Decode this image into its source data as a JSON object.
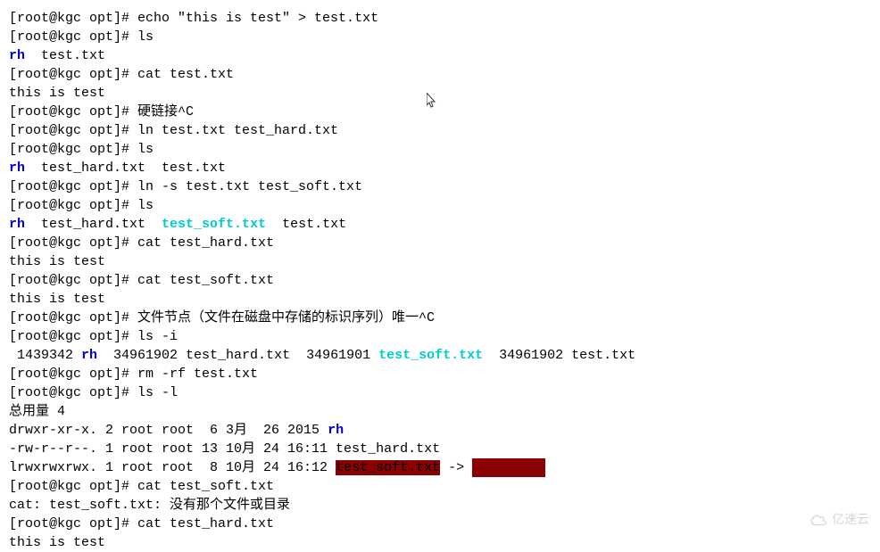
{
  "lines": [
    {
      "parts": [
        {
          "text": "[root@kgc opt]# echo \"this is test\" > test.txt"
        }
      ]
    },
    {
      "parts": [
        {
          "text": "[root@kgc opt]# ls"
        }
      ]
    },
    {
      "parts": [
        {
          "text": "rh",
          "cls": "blue"
        },
        {
          "text": "  test.txt"
        }
      ]
    },
    {
      "parts": [
        {
          "text": "[root@kgc opt]# cat test.txt"
        }
      ]
    },
    {
      "parts": [
        {
          "text": "this is test"
        }
      ]
    },
    {
      "parts": [
        {
          "text": "[root@kgc opt]# 硬链接^C"
        }
      ]
    },
    {
      "parts": [
        {
          "text": "[root@kgc opt]# ln test.txt test_hard.txt"
        }
      ]
    },
    {
      "parts": [
        {
          "text": "[root@kgc opt]# ls"
        }
      ]
    },
    {
      "parts": [
        {
          "text": "rh",
          "cls": "blue"
        },
        {
          "text": "  test_hard.txt  test.txt"
        }
      ]
    },
    {
      "parts": [
        {
          "text": "[root@kgc opt]# ln -s test.txt test_soft.txt"
        }
      ]
    },
    {
      "parts": [
        {
          "text": "[root@kgc opt]# ls"
        }
      ]
    },
    {
      "parts": [
        {
          "text": "rh",
          "cls": "blue"
        },
        {
          "text": "  test_hard.txt  "
        },
        {
          "text": "test_soft.txt",
          "cls": "cyan"
        },
        {
          "text": "  test.txt"
        }
      ]
    },
    {
      "parts": [
        {
          "text": "[root@kgc opt]# cat test_hard.txt"
        }
      ]
    },
    {
      "parts": [
        {
          "text": "this is test"
        }
      ]
    },
    {
      "parts": [
        {
          "text": "[root@kgc opt]# cat test_soft.txt"
        }
      ]
    },
    {
      "parts": [
        {
          "text": "this is test"
        }
      ]
    },
    {
      "parts": [
        {
          "text": "[root@kgc opt]# 文件节点（文件在磁盘中存储的标识序列）唯一^C"
        }
      ]
    },
    {
      "parts": [
        {
          "text": "[root@kgc opt]# ls -i"
        }
      ]
    },
    {
      "parts": [
        {
          "text": " 1439342 "
        },
        {
          "text": "rh",
          "cls": "blue"
        },
        {
          "text": "  34961902 test_hard.txt  34961901 "
        },
        {
          "text": "test_soft.txt",
          "cls": "cyan"
        },
        {
          "text": "  34961902 test.txt"
        }
      ]
    },
    {
      "parts": [
        {
          "text": "[root@kgc opt]# rm -rf test.txt"
        }
      ]
    },
    {
      "parts": [
        {
          "text": "[root@kgc opt]# ls -l"
        }
      ]
    },
    {
      "parts": [
        {
          "text": "总用量 4"
        }
      ]
    },
    {
      "parts": [
        {
          "text": "drwxr-xr-x. 2 root root  6 3月  26 2015 "
        },
        {
          "text": "rh",
          "cls": "blue"
        }
      ]
    },
    {
      "parts": [
        {
          "text": "-rw-r--r--. 1 root root 13 10月 24 16:11 test_hard.txt"
        }
      ]
    },
    {
      "parts": [
        {
          "text": "lrwxrwxrwx. 1 root root  8 10月 24 16:12 "
        },
        {
          "text": "test_soft.txt",
          "cls": "redbg"
        },
        {
          "text": " -> "
        },
        {
          "text": " ",
          "cls": "redblank"
        }
      ]
    },
    {
      "parts": [
        {
          "text": "[root@kgc opt]# cat test_soft.txt"
        }
      ]
    },
    {
      "parts": [
        {
          "text": "cat: test_soft.txt: 没有那个文件或目录"
        }
      ]
    },
    {
      "parts": [
        {
          "text": "[root@kgc opt]# cat test_hard.txt"
        }
      ]
    },
    {
      "parts": [
        {
          "text": "this is test"
        }
      ]
    }
  ],
  "watermark": "亿速云"
}
